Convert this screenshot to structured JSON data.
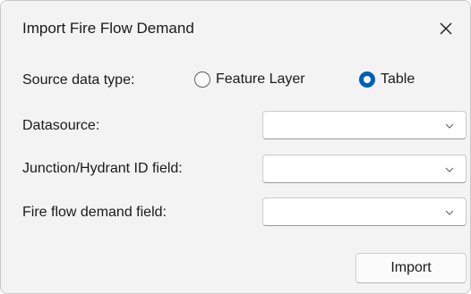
{
  "dialog": {
    "title": "Import Fire Flow Demand",
    "close_icon": "close-icon"
  },
  "source_type": {
    "label": "Source data type:",
    "options": [
      {
        "label": "Feature Layer",
        "selected": false
      },
      {
        "label": "Table",
        "selected": true
      }
    ]
  },
  "fields": {
    "datasource": {
      "label": "Datasource:",
      "value": "",
      "icon": "chevron-down-icon"
    },
    "junction_id": {
      "label": "Junction/Hydrant ID field:",
      "value": "",
      "icon": "chevron-down-icon"
    },
    "demand_field": {
      "label": "Fire flow demand field:",
      "value": "",
      "icon": "chevron-down-icon"
    }
  },
  "actions": {
    "import_label": "Import"
  },
  "colors": {
    "accent": "#005fb8",
    "dialog_bg": "#f3f3f3",
    "input_bg": "#ffffff"
  }
}
